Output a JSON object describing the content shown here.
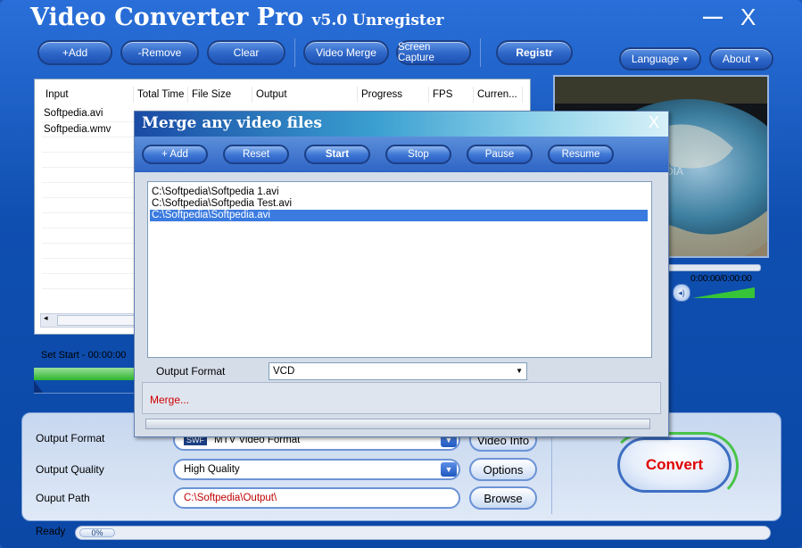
{
  "app": {
    "title": "Video Converter Pro",
    "version": "v5.0 Unregister",
    "controls": {
      "minimize": "—",
      "close": "X"
    }
  },
  "toolbar": {
    "add": "+Add",
    "remove": "-Remove",
    "clear": "Clear",
    "video_merge": "Video Merge",
    "screen_capture": "Screen Capture",
    "register": "Registr",
    "language": "Language",
    "about": "About"
  },
  "file_table": {
    "columns": [
      "Input",
      "Total Time",
      "File Size",
      "Output",
      "Progress",
      "FPS",
      "Curren..."
    ],
    "rows": [
      {
        "input": "Softpedia.avi"
      },
      {
        "input": "Softpedia.wmv"
      }
    ]
  },
  "player": {
    "time": "0:00:00/0:00:00",
    "set_start": "Set Start - 00:00:00"
  },
  "settings": {
    "output_format_label": "Output Format",
    "output_format_badge": "SWF",
    "output_format_value": "MTV Video Format",
    "output_quality_label": "Output Quality",
    "output_quality_value": "High Quality",
    "output_path_label": "Ouput Path",
    "output_path_value": "C:\\Softpedia\\Output\\",
    "video_info_button": "Video Info",
    "options_button": "Options",
    "browse_button": "Browse",
    "convert_button": "Convert"
  },
  "status": {
    "text": "Ready",
    "progress_text": "0%",
    "progress": 0
  },
  "merge_dialog": {
    "title": "Merge any video files",
    "close": "X",
    "buttons": {
      "add": "+ Add",
      "reset": "Reset",
      "start": "Start",
      "stop": "Stop",
      "pause": "Pause",
      "resume": "Resume"
    },
    "files": [
      "C:\\Softpedia\\Softpedia 1.avi",
      "C:\\Softpedia\\Softpedia Test.avi",
      "C:\\Softpedia\\Softpedia.avi"
    ],
    "selected_index": 2,
    "output_format_label": "Output Format",
    "output_format_value": "VCD",
    "status_text": "Merge..."
  },
  "colors": {
    "window_blue": "#1c57b8",
    "selection": "#3b7be0",
    "convert_text": "#e00000",
    "merge_status": "#d00000",
    "progress_green": "#2cb52c"
  }
}
